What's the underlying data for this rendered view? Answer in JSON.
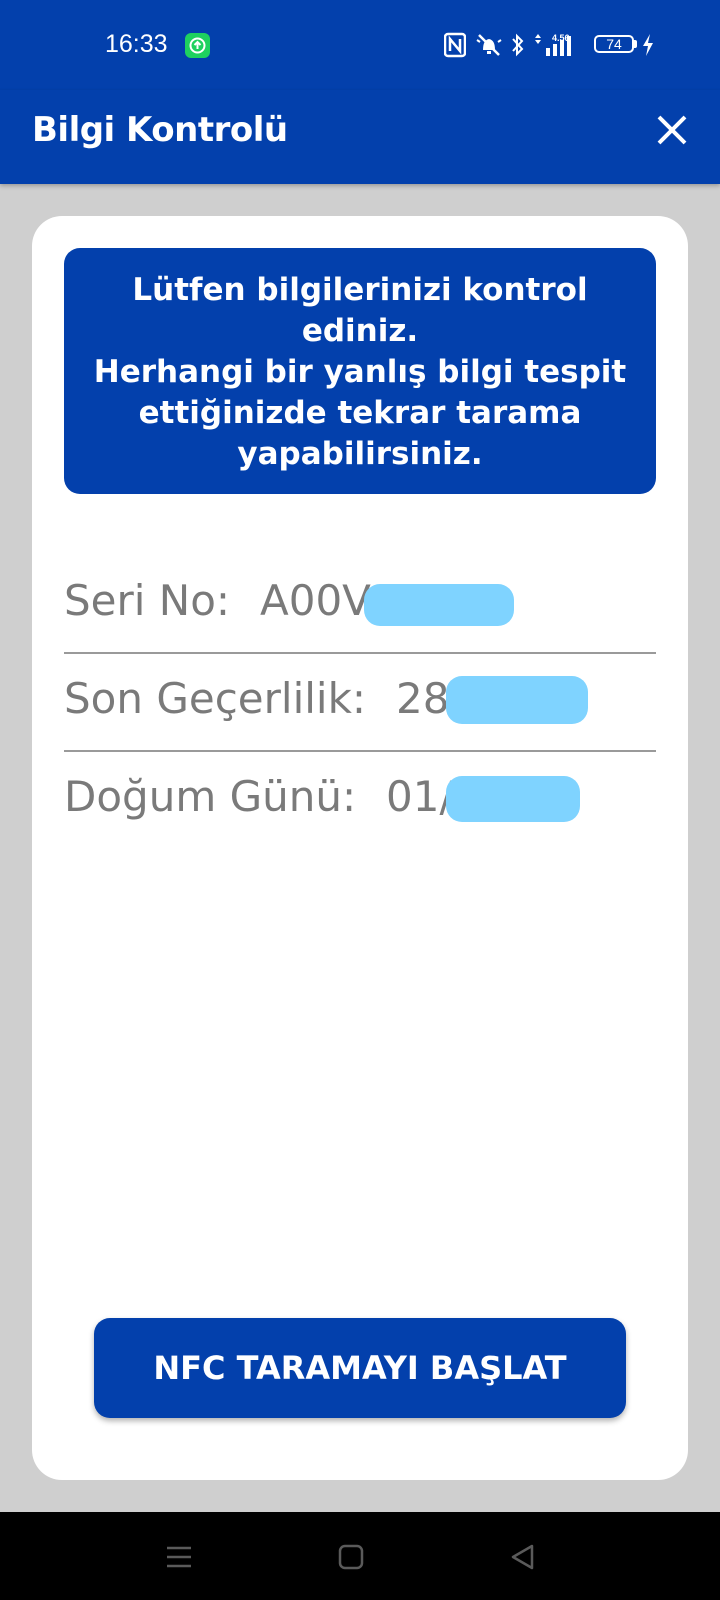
{
  "status_bar": {
    "time": "16:33",
    "network_speed": "4.56",
    "battery_level": "74",
    "icons": [
      "app-notification-icon",
      "nfc-icon",
      "muted-bell-icon",
      "bluetooth-icon",
      "signal-icon",
      "battery-icon",
      "charging-icon"
    ]
  },
  "app_bar": {
    "title": "Bilgi Kontrolü",
    "close_icon": "close-icon"
  },
  "info_box": {
    "lines": [
      "Lütfen bilgilerinizi kontrol",
      "ediniz.",
      "Herhangi bir yanlış bilgi tespit",
      "ettiğinizde tekrar tarama",
      "yapabilirsiniz."
    ]
  },
  "fields": [
    {
      "label": "Seri No:",
      "value": "A00V"
    },
    {
      "label": "Son Geçerlilik:",
      "value": "28/"
    },
    {
      "label": "Doğum Günü:",
      "value": "01/"
    }
  ],
  "button": {
    "label": "NFC TARAMAYI BAŞLAT"
  },
  "nav_bar": {
    "icons": [
      "menu-icon",
      "home-icon",
      "back-icon"
    ]
  },
  "colors": {
    "primary": "#0340ac",
    "background": "#cfcfcf",
    "card": "#ffffff",
    "field_text": "#7a7a7a",
    "redaction": "#7fd3ff"
  }
}
